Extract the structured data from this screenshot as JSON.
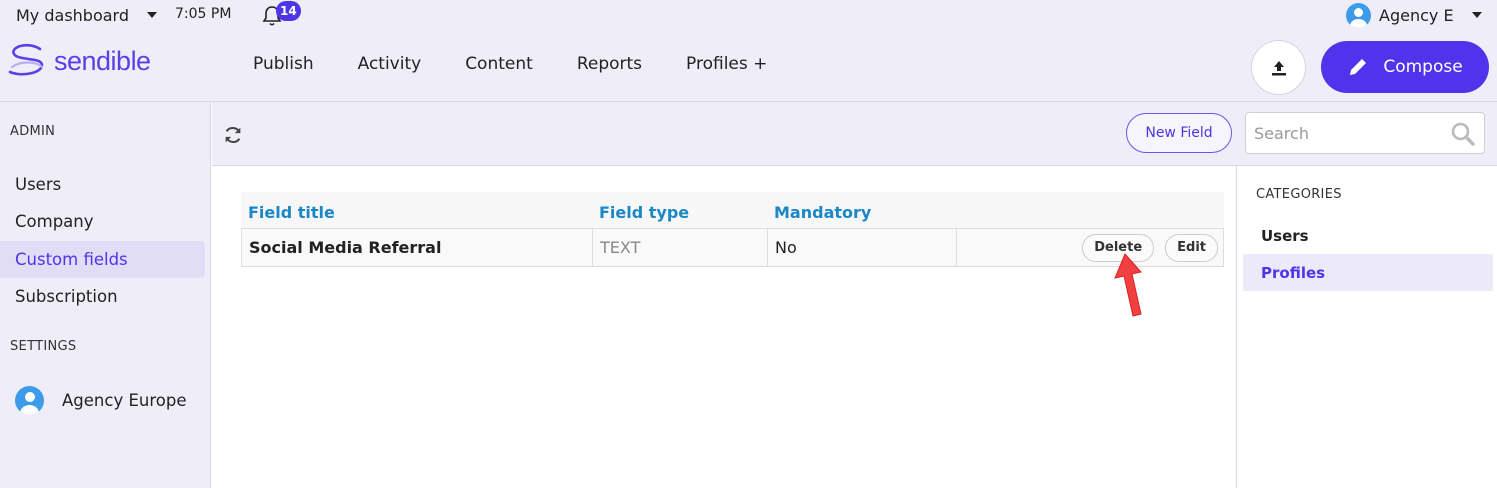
{
  "header": {
    "dashboard_label": "My dashboard",
    "time": "7:05 PM",
    "notification_count": "14",
    "account_label": "Agency E",
    "brand": "sendible",
    "nav": [
      "Publish",
      "Activity",
      "Content",
      "Reports",
      "Profiles +"
    ],
    "compose_label": "Compose"
  },
  "sidebar": {
    "admin_label": "ADMIN",
    "admin_items": [
      {
        "label": "Users",
        "active": false
      },
      {
        "label": "Company",
        "active": false
      },
      {
        "label": "Custom fields",
        "active": true
      },
      {
        "label": "Subscription",
        "active": false
      }
    ],
    "settings_label": "SETTINGS",
    "agency_name": "Agency Europe"
  },
  "toolbar": {
    "new_field_label": "New Field",
    "search_placeholder": "Search"
  },
  "table": {
    "columns": [
      "Field title",
      "Field type",
      "Mandatory"
    ],
    "rows": [
      {
        "title": "Social Media Referral",
        "type": "TEXT",
        "mandatory": "No",
        "delete_label": "Delete",
        "edit_label": "Edit"
      }
    ]
  },
  "categories": {
    "label": "CATEGORIES",
    "items": [
      {
        "label": "Users",
        "active": false
      },
      {
        "label": "Profiles",
        "active": true
      }
    ]
  },
  "colors": {
    "brand": "#5133ec",
    "header_bg": "#efedf7",
    "column_header": "#1a87c6",
    "annotation_arrow": "#f04040"
  }
}
